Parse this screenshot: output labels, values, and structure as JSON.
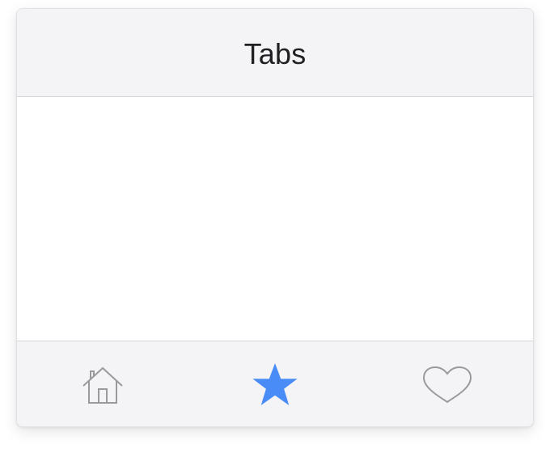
{
  "nav": {
    "title": "Tabs"
  },
  "tabs": [
    {
      "icon": "home-icon",
      "selected": false
    },
    {
      "icon": "star-icon",
      "selected": true
    },
    {
      "icon": "heart-icon",
      "selected": false
    }
  ],
  "colors": {
    "bar_background": "#f4f4f6",
    "separator": "#d6d6da",
    "title_text": "#1f1f24",
    "tab_active": "#4a8cf7",
    "tab_inactive": "#9a9a9e",
    "content_background": "#ffffff"
  }
}
